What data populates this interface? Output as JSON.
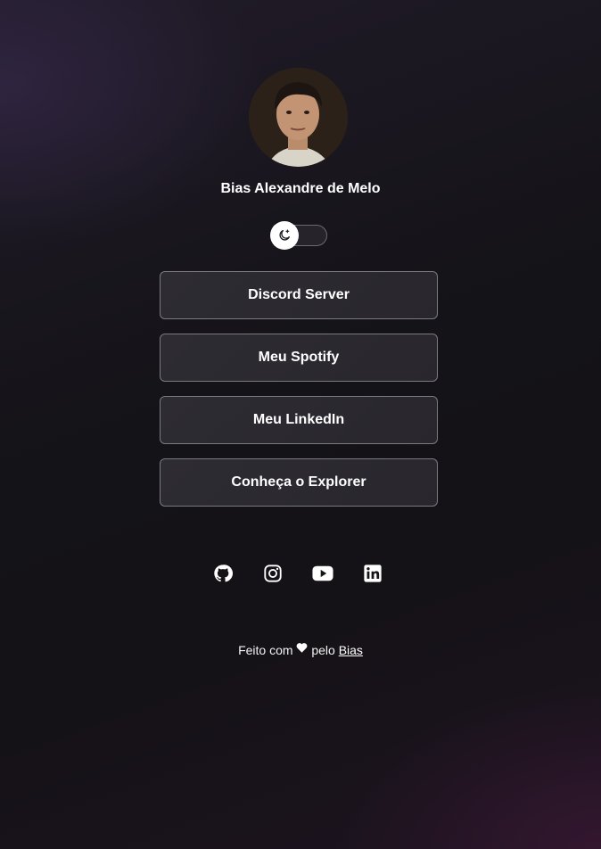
{
  "profile": {
    "name": "Bias Alexandre de Melo",
    "avatar_alt": "avatar"
  },
  "theme_toggle": {
    "icon": "moon-stars-icon",
    "state": "dark"
  },
  "links": [
    {
      "label": "Discord Server"
    },
    {
      "label": "Meu Spotify"
    },
    {
      "label": "Meu LinkedIn"
    },
    {
      "label": "Conheça o Explorer"
    }
  ],
  "socials": [
    {
      "icon": "github-icon"
    },
    {
      "icon": "instagram-icon"
    },
    {
      "icon": "youtube-icon"
    },
    {
      "icon": "linkedin-icon"
    }
  ],
  "footer": {
    "prefix": "Feito com",
    "heart_icon": "heart-icon",
    "middle": "pelo",
    "author_link": "Bias"
  },
  "colors": {
    "background": "#151418",
    "button_bg": "#2c2a30",
    "button_border": "#7a7a80",
    "text": "#ffffff"
  }
}
